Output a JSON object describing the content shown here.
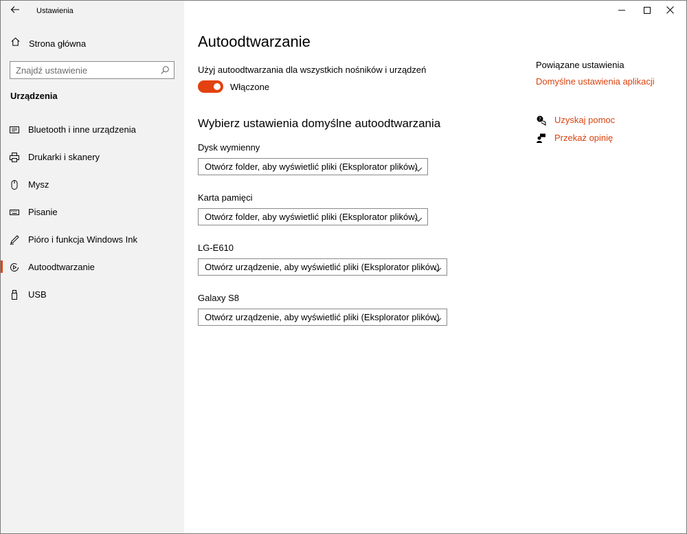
{
  "window": {
    "title": "Ustawienia"
  },
  "sidebar": {
    "home_label": "Strona główna",
    "search_placeholder": "Znajdź ustawienie",
    "section_title": "Urządzenia",
    "items": [
      {
        "label": "Bluetooth i inne urządzenia",
        "icon": "bluetooth-devices-icon",
        "selected": false
      },
      {
        "label": "Drukarki i skanery",
        "icon": "printer-icon",
        "selected": false
      },
      {
        "label": "Mysz",
        "icon": "mouse-icon",
        "selected": false
      },
      {
        "label": "Pisanie",
        "icon": "keyboard-icon",
        "selected": false
      },
      {
        "label": "Pióro i funkcja Windows Ink",
        "icon": "pen-icon",
        "selected": false
      },
      {
        "label": "Autoodtwarzanie",
        "icon": "autoplay-icon",
        "selected": true
      },
      {
        "label": "USB",
        "icon": "usb-icon",
        "selected": false
      }
    ]
  },
  "main": {
    "title": "Autoodtwarzanie",
    "toggle_label": "Użyj autoodtwarzania dla wszystkich nośników i urządzeń",
    "toggle_state": "Włączone",
    "toggle_on": true,
    "subheading": "Wybierz ustawienia domyślne autoodtwarzania",
    "devices": [
      {
        "label": "Dysk wymienny",
        "value": "Otwórz folder, aby wyświetlić pliki (Eksplorator plików)"
      },
      {
        "label": "Karta pamięci",
        "value": "Otwórz folder, aby wyświetlić pliki (Eksplorator plików)"
      },
      {
        "label": "LG-E610",
        "value": "Otwórz urządzenie, aby wyświetlić pliki (Eksplorator plików)"
      },
      {
        "label": "Galaxy S8",
        "value": "Otwórz urządzenie, aby wyświetlić pliki (Eksplorator plików)"
      }
    ]
  },
  "related": {
    "heading": "Powiązane ustawienia",
    "link": "Domyślne ustawienia aplikacji",
    "help_label": "Uzyskaj pomoc",
    "feedback_label": "Przekaż opinię"
  },
  "colors": {
    "accent": "#e3410f",
    "link": "#d8430f",
    "sidebar_bg": "#f2f2f2"
  }
}
